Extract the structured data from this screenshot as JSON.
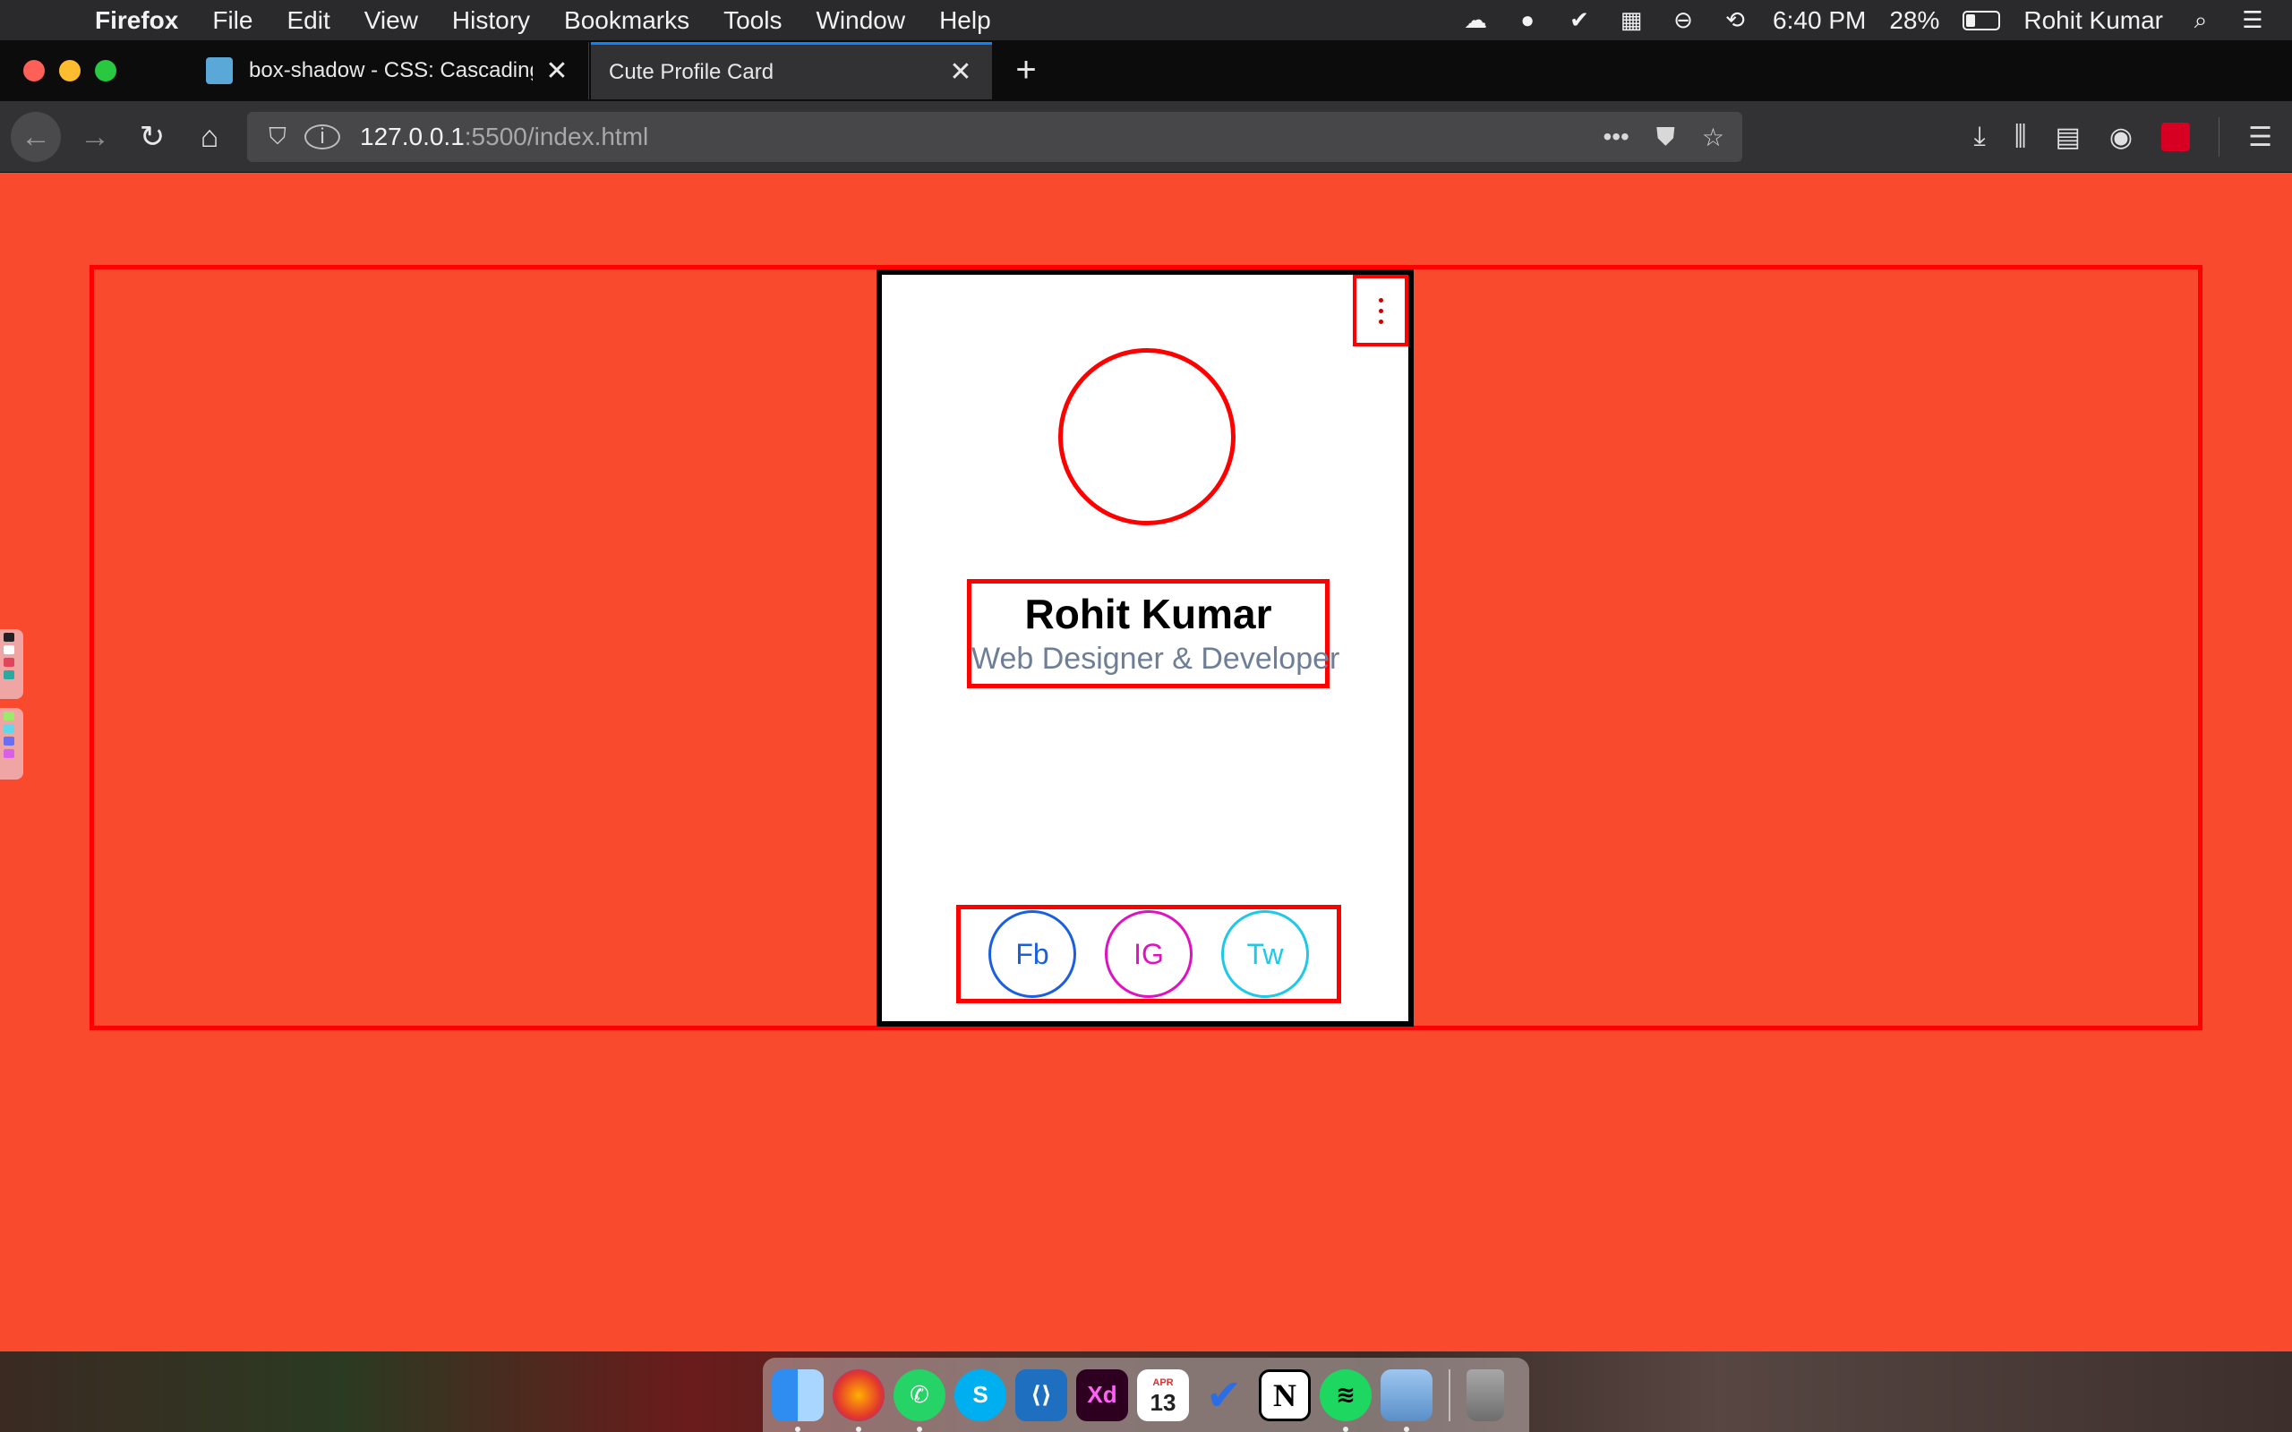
{
  "menubar": {
    "app_name": "Firefox",
    "menus": [
      "File",
      "Edit",
      "View",
      "History",
      "Bookmarks",
      "Tools",
      "Window",
      "Help"
    ],
    "clock": "6:40 PM",
    "battery_percent": "28%",
    "battery_level": 0.28,
    "user_name": "Rohit Kumar"
  },
  "tabs": [
    {
      "title": "box-shadow - CSS: Cascading Style Sheets",
      "active": false
    },
    {
      "title": "Cute Profile Card",
      "active": true
    }
  ],
  "urlbar": {
    "host": "127.0.0.1",
    "path": ":5500/index.html"
  },
  "page": {
    "background_color": "#fa4a2e",
    "profile": {
      "name": "Rohit Kumar",
      "role": "Web Designer & Developer"
    },
    "social": [
      {
        "label": "Fb",
        "color": "#1a5fe0"
      },
      {
        "label": "IG",
        "color": "#e011c0"
      },
      {
        "label": "Tw",
        "color": "#1ec8e8"
      }
    ]
  },
  "dock": {
    "apps": [
      "Finder",
      "Firefox",
      "WhatsApp",
      "Skype",
      "Visual Studio Code",
      "Adobe XD",
      "Calendar",
      "Microsoft To Do",
      "Notion",
      "Spotify",
      "Preview",
      "Trash"
    ],
    "calendar_month": "APR",
    "calendar_day": "13",
    "xd_label": "Xd",
    "notion_label": "N",
    "skype_label": "S"
  }
}
